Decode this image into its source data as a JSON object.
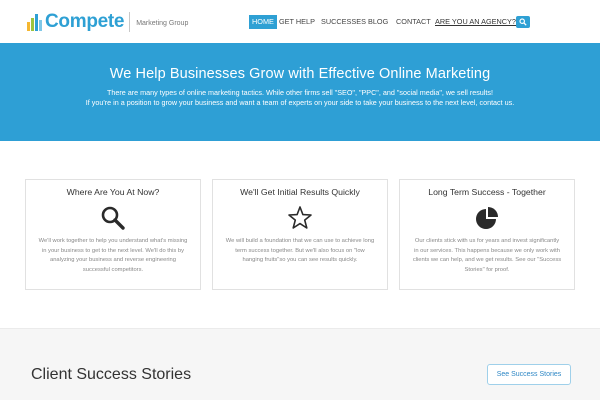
{
  "brand": {
    "name": "Compete",
    "tagline": "Marketing Group",
    "colors": {
      "primary": "#2ea0d4",
      "logo_bar_1": "#f5b731",
      "logo_bar_2": "#9dc43d",
      "logo_bar_3": "#2ea0d4"
    }
  },
  "nav": {
    "items": [
      {
        "label": "HOME",
        "active": true
      },
      {
        "label": "GET HELP"
      },
      {
        "label": "SUCCESSES"
      },
      {
        "label": "BLOG"
      },
      {
        "label": "CONTACT"
      },
      {
        "label": "ARE YOU AN AGENCY?"
      }
    ],
    "search_icon": "search-icon"
  },
  "hero": {
    "title": "We Help Businesses Grow with Effective Online Marketing",
    "line1": "There are many types of online marketing tactics. While other firms sell \"SEO\", \"PPC\", and \"social media\", we sell results!",
    "line2": "If you're in a position to grow your business and want a team of experts on your side to take your business to the next level, contact us."
  },
  "features": [
    {
      "title": "Where Are You At Now?",
      "icon": "magnifier-icon",
      "text": "We'll work together to help you understand what's missing in your business to get to the next level. We'll do this by analyzing your business and reverse engineering successful competitors."
    },
    {
      "title": "We'll Get Initial Results Quickly",
      "icon": "star-icon",
      "text": "We will build a foundation that we can use to achieve long term success together. But we'll also focus on \"low hanging fruits\"so you can see results quickly."
    },
    {
      "title": "Long Term Success - Together",
      "icon": "pie-chart-icon",
      "text": "Our clients stick with us for years and invest significantly in our services. This happens because we only work with clients we can help, and we get results. See our \"Success Stories\" for proof."
    }
  ],
  "stories": {
    "title": "Client Success Stories",
    "button": "See Success Stories"
  }
}
